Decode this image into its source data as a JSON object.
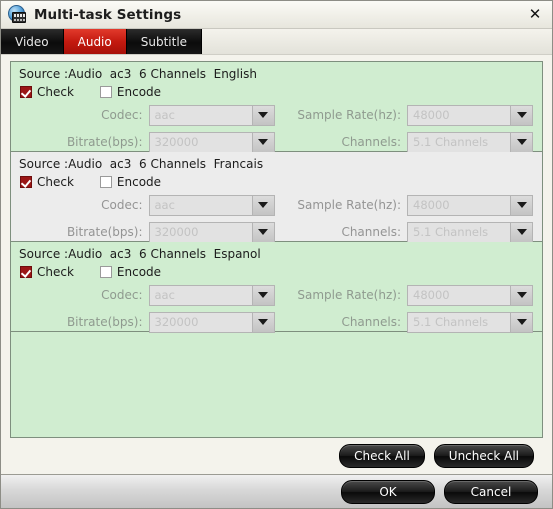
{
  "window": {
    "title": "Multi-task Settings",
    "icon": "disc-film-icon",
    "close_label": "✕"
  },
  "tabs": [
    {
      "label": "Video",
      "active": false
    },
    {
      "label": "Audio",
      "active": true
    },
    {
      "label": "Subtitle",
      "active": false
    }
  ],
  "labels": {
    "check": "Check",
    "encode": "Encode",
    "codec": "Codec:",
    "bitrate": "Bitrate(bps):",
    "sample_rate": "Sample Rate(hz):",
    "channels": "Channels:"
  },
  "sections": [
    {
      "source": "Source :Audio  ac3  6 Channels  English",
      "checked": true,
      "encode": false,
      "codec": "aac",
      "bitrate": "320000",
      "sample_rate": "48000",
      "channels": "5.1 Channels",
      "background": "green"
    },
    {
      "source": "Source :Audio  ac3  6 Channels  Francais",
      "checked": true,
      "encode": false,
      "codec": "aac",
      "bitrate": "320000",
      "sample_rate": "48000",
      "channels": "5.1 Channels",
      "background": "grey"
    },
    {
      "source": "Source :Audio  ac3  6 Channels  Espanol",
      "checked": true,
      "encode": false,
      "codec": "aac",
      "bitrate": "320000",
      "sample_rate": "48000",
      "channels": "5.1 Channels",
      "background": "green"
    }
  ],
  "actions": {
    "check_all": "Check All",
    "uncheck_all": "Uncheck All",
    "ok": "OK",
    "cancel": "Cancel"
  },
  "colors": {
    "panel_green": "#d0edd0",
    "panel_grey": "#ececec",
    "tab_active": "#c41a10",
    "checkbox_checked": "#9b1616"
  }
}
